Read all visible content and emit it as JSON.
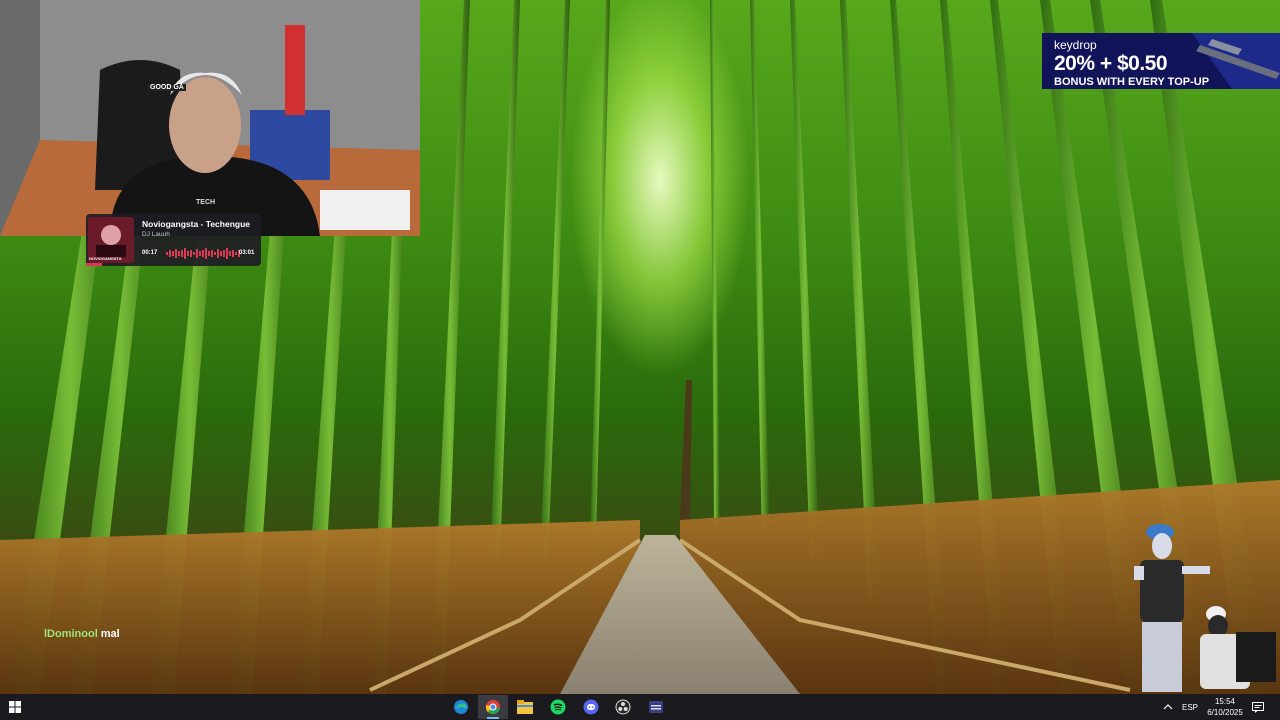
{
  "stream": {
    "song_widget": {
      "title": "Noviogangsta - Techengue",
      "artist": "DJ Lauuh",
      "cover_text": "NOVIOGANGSTA",
      "elapsed": "00:17",
      "duration": "03:01",
      "progress": 0.09,
      "accent_color": "#d93b56"
    },
    "ad_banner": {
      "brand": "keydrop",
      "headline": "20% + $0.50",
      "subline": "BONUS WITH EVERY TOP-UP"
    },
    "chat": {
      "username": "lDominool",
      "message": "mal"
    },
    "webcam": {
      "chair_label": "GOOD GA",
      "shirt_text": "TECH"
    }
  },
  "taskbar": {
    "start_icon": "windows-logo-icon",
    "apps": [
      {
        "name": "edge-icon"
      },
      {
        "name": "chrome-icon",
        "active": true
      },
      {
        "name": "file-explorer-icon"
      },
      {
        "name": "spotify-icon"
      },
      {
        "name": "discord-icon"
      },
      {
        "name": "obs-icon"
      },
      {
        "name": "app-icon"
      }
    ],
    "tray": {
      "chevron_icon": "chevron-up-icon",
      "language": "ESP",
      "time": "15:54",
      "date": "6/10/2025",
      "notification_icon": "notification-icon"
    }
  }
}
